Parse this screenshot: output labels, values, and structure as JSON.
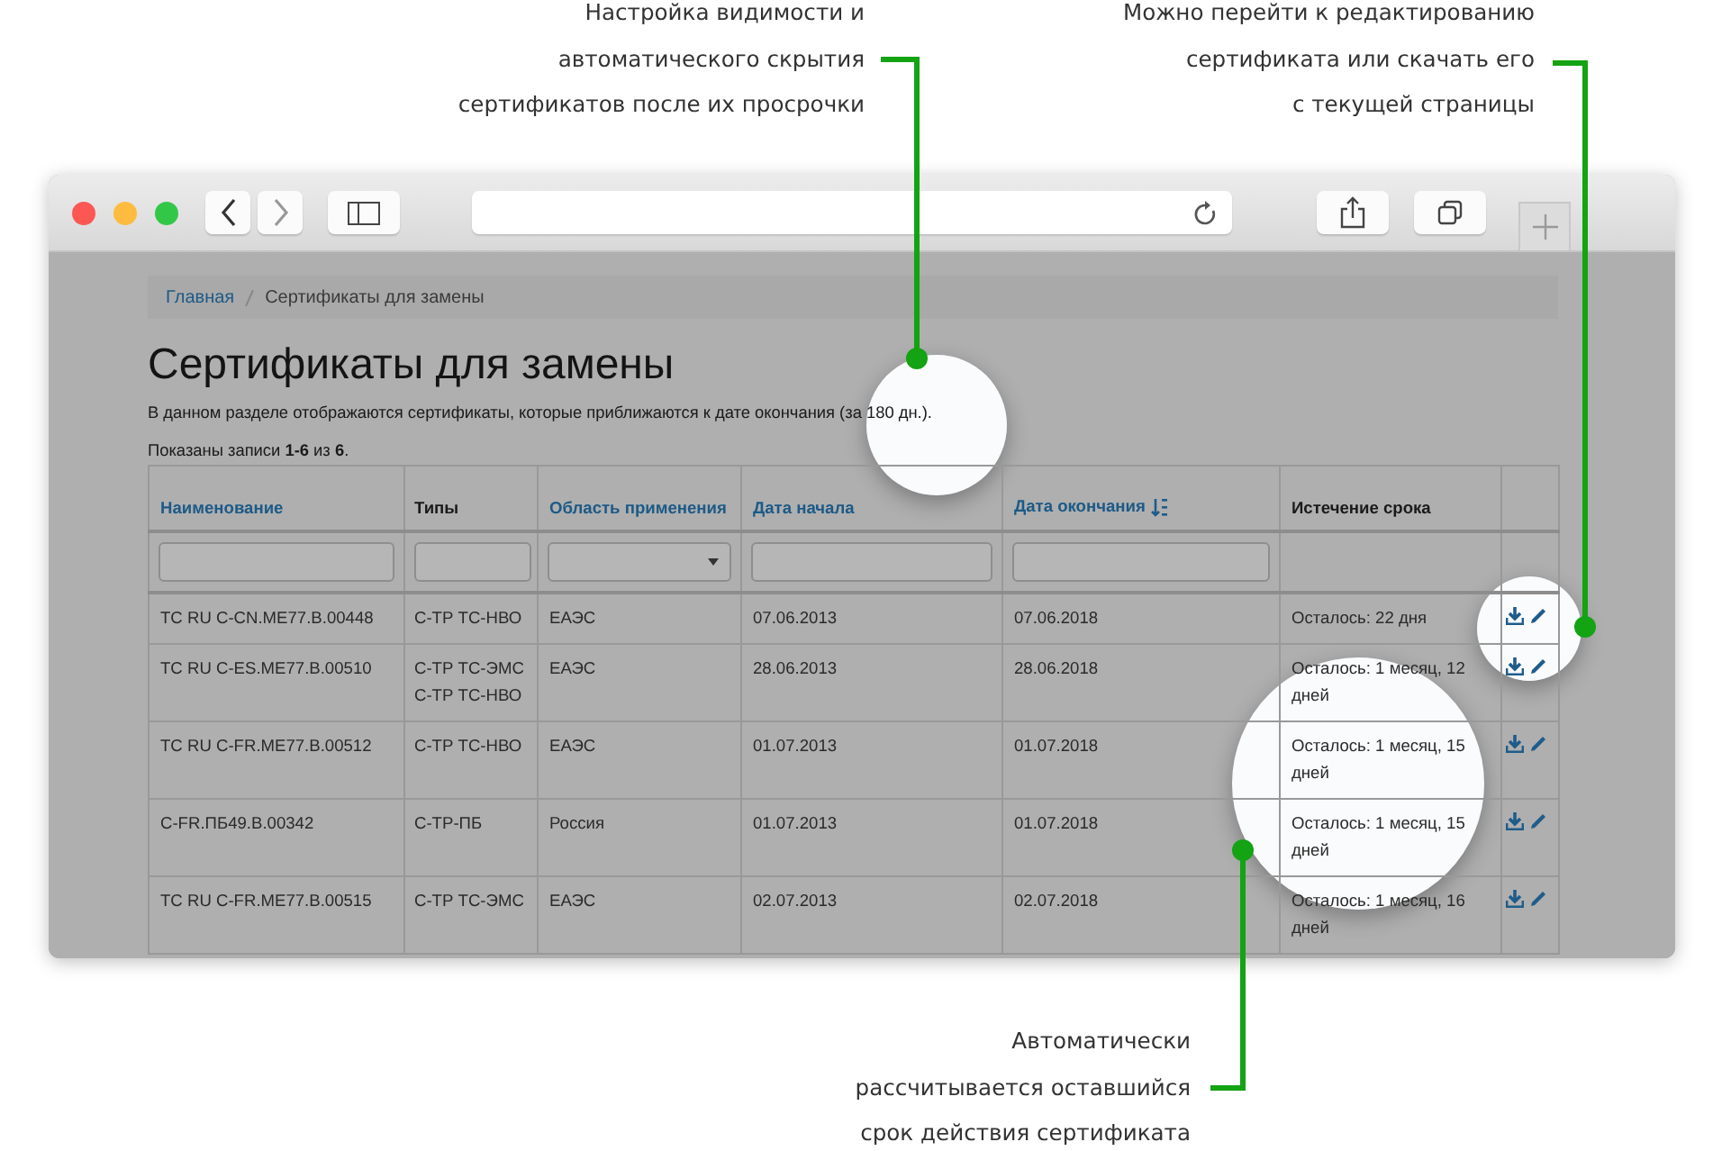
{
  "annotations": [
    {
      "text": "Настройка видимости и\nавтоматического скрытия\nсертификатов после их просрочки"
    },
    {
      "text": "Можно перейти к редактированию\nсертификата или скачать его\nс текущей страницы"
    },
    {
      "text": "Автоматически\nрассчитывается оставшийся\nсрок действия сертификата"
    }
  ],
  "breadcrumb": [
    {
      "label": "Главная",
      "link": true
    },
    {
      "label": "Сертификаты для замены",
      "link": false
    }
  ],
  "page": {
    "title": "Сертификаты для замены",
    "description": "В данном разделе отображаются сертификаты, которые приближаются к дате окончания (за 180 дн.).",
    "summary": "Показаны записи **1-6** из **6**."
  },
  "table": {
    "columns": [
      {
        "label": "Наименование",
        "link": true,
        "filter": {
          "kind": "text"
        }
      },
      {
        "label": "Типы",
        "link": false,
        "filter": {
          "kind": "text"
        }
      },
      {
        "label": "Область применения",
        "link": true,
        "filter": {
          "kind": "select"
        }
      },
      {
        "label": "Дата начала",
        "link": true,
        "filter": {
          "kind": "text"
        }
      },
      {
        "label": "Дата окончания",
        "link": true,
        "filter": {
          "kind": "text"
        },
        "sorted": true
      },
      {
        "label": "Истечение срока",
        "link": false
      },
      {
        "kind": "actions"
      }
    ],
    "rows": [
      {
        "name": "TC RU C-CN.ME77.B.00448",
        "types": [
          "С-ТР ТС-НВО"
        ],
        "area": "ЕАЭС",
        "start": "07.06.2013",
        "end": "07.06.2018",
        "remaining": "Осталось: 22 дня"
      },
      {
        "name": "TC RU C-ES.ME77.B.00510",
        "types": [
          "С-ТР ТС-ЭМС",
          "С-ТР ТС-НВО"
        ],
        "area": "ЕАЭС",
        "start": "28.06.2013",
        "end": "28.06.2018",
        "remaining": "Осталось: 1 месяц, 12 дней"
      },
      {
        "name": "TC RU C-FR.ME77.B.00512",
        "types": [
          "С-ТР ТС-НВО"
        ],
        "area": "ЕАЭС",
        "start": "01.07.2013",
        "end": "01.07.2018",
        "remaining": "Осталось: 1 месяц, 15 дней"
      },
      {
        "name": "C-FR.ПБ49.B.00342",
        "types": [
          "С-ТР-ПБ"
        ],
        "area": "Россия",
        "start": "01.07.2013",
        "end": "01.07.2018",
        "remaining": "Осталось: 1 месяц, 15 дней"
      },
      {
        "name": "TC RU C-FR.ME77.B.00515",
        "types": [
          "С-ТР ТС-ЭМС"
        ],
        "area": "ЕАЭС",
        "start": "02.07.2013",
        "end": "02.07.2018",
        "remaining": "Осталось: 1 месяц, 16 дней"
      }
    ]
  }
}
